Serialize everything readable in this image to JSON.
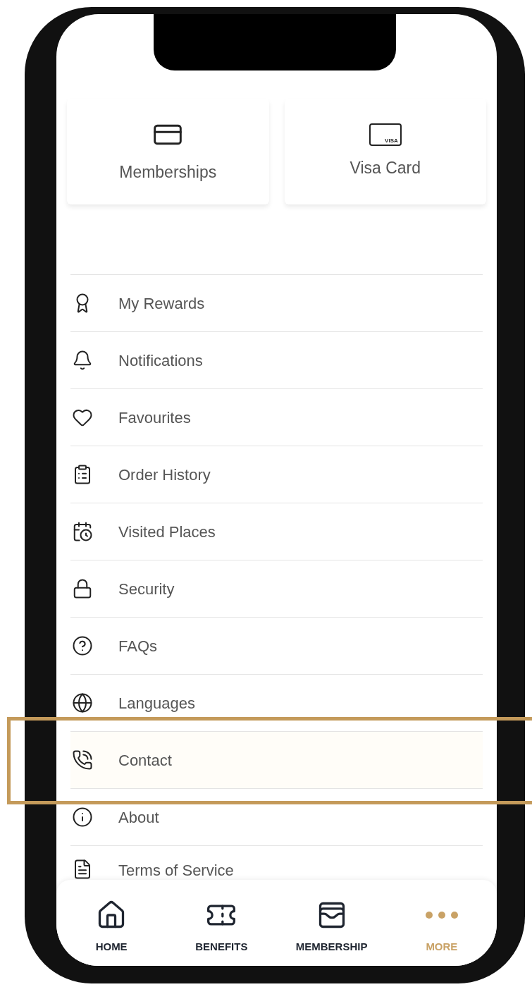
{
  "cards": [
    {
      "label": "Memberships",
      "kind": "membership"
    },
    {
      "label": "Visa Card",
      "kind": "visa",
      "badge": "VISA"
    }
  ],
  "menu": [
    {
      "label": "My Rewards",
      "highlighted": false
    },
    {
      "label": "Notifications",
      "highlighted": false
    },
    {
      "label": "Favourites",
      "highlighted": false
    },
    {
      "label": "Order History",
      "highlighted": false
    },
    {
      "label": "Visited Places",
      "highlighted": false
    },
    {
      "label": "Security",
      "highlighted": false
    },
    {
      "label": "FAQs",
      "highlighted": false
    },
    {
      "label": "Languages",
      "highlighted": false
    },
    {
      "label": "Contact",
      "highlighted": true
    },
    {
      "label": "About",
      "highlighted": false
    },
    {
      "label": "Terms of Service",
      "highlighted": false
    }
  ],
  "bottom_nav": [
    {
      "label": "HOME",
      "selected": false
    },
    {
      "label": "BENEFITS",
      "selected": false
    },
    {
      "label": "MEMBERSHIP",
      "selected": false
    },
    {
      "label": "MORE",
      "selected": true
    }
  ]
}
